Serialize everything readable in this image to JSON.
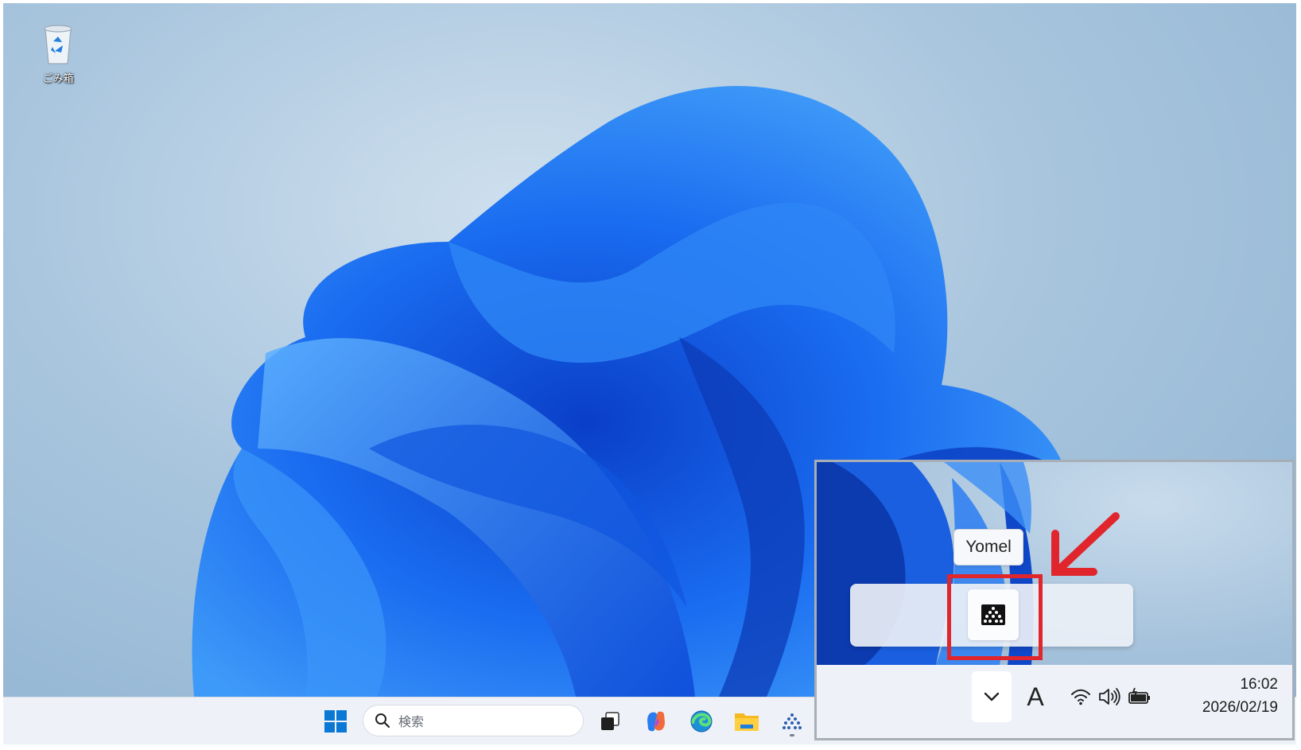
{
  "desktop": {
    "recycle_bin_label": "ごみ箱"
  },
  "taskbar": {
    "search_placeholder": "検索",
    "apps": [
      {
        "name": "windows-start",
        "icon": "windows-logo-icon"
      },
      {
        "name": "task-view",
        "icon": "task-view-icon"
      },
      {
        "name": "copilot",
        "icon": "copilot-icon"
      },
      {
        "name": "edge",
        "icon": "edge-icon"
      },
      {
        "name": "file-explorer",
        "icon": "folder-icon"
      },
      {
        "name": "yomel",
        "icon": "yomel-icon",
        "running": true
      }
    ]
  },
  "inset": {
    "tooltip": "Yomel",
    "ime_indicator": "A",
    "clock_time": "16:02",
    "clock_date": "2026/02/19"
  },
  "colors": {
    "highlight_red": "#e0262c",
    "taskbar_bg": "#eef2f8",
    "windows_blue": "#0a78d4"
  }
}
